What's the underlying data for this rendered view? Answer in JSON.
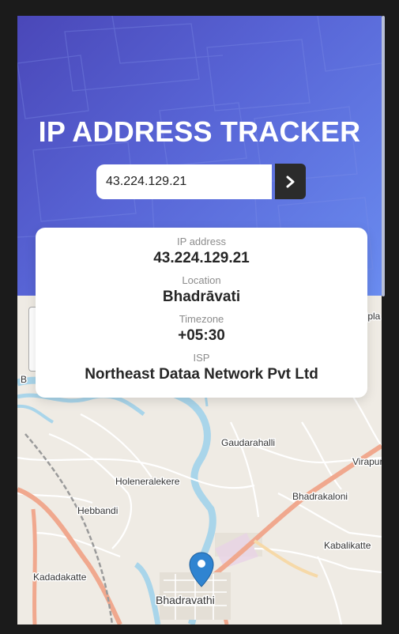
{
  "header": {
    "title": "IP ADDRESS TRACKER",
    "background_start": "#4a47b8",
    "background_end": "#6a8cf0"
  },
  "search": {
    "value": "43.224.129.21",
    "button_icon": "chevron-right-icon",
    "button_color": "#2b2b2b"
  },
  "info": {
    "ip_label": "IP address",
    "ip_value": "43.224.129.21",
    "location_label": "Location",
    "location_value": "Bhadrāvati",
    "timezone_label": "Timezone",
    "timezone_value": "+05:30",
    "isp_label": "ISP",
    "isp_value": "Northeast Dataa Network Pvt Ltd"
  },
  "map": {
    "places": {
      "gaudarahalli": "Gaudarahalli",
      "holeneralekere": "Holeneralekere",
      "hebbandi": "Hebbandi",
      "bhadrakaloni": "Bhadrakaloni",
      "kabalikatte": "Kabalikatte",
      "kadadakatte": "Kadadakatte",
      "virapura": "Virapur",
      "bhadravati": "Bhadravathi",
      "top_right": "Ipla",
      "left_fragment": "B"
    },
    "marker_icon": "map-pin-icon",
    "marker_color": "#2f84d1",
    "river_color": "#a9d5ea",
    "road_color": "#f0a88e"
  }
}
